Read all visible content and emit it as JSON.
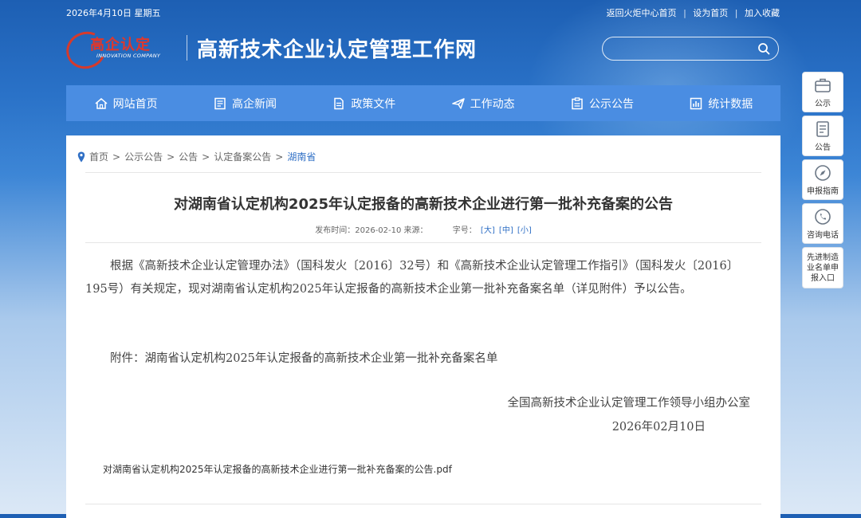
{
  "topbar": {
    "date": "2026年4月10日 星期五",
    "links": [
      "返回火炬中心首页",
      "设为首页",
      "加入收藏"
    ],
    "separator": "|"
  },
  "logo": {
    "brand": "高企认定",
    "brand_en": "INNOVATION COMPANY"
  },
  "site_title": "高新技术企业认定管理工作网",
  "search": {
    "placeholder": "",
    "icon": "search-icon"
  },
  "nav": [
    {
      "label": "网站首页",
      "icon": "home-icon"
    },
    {
      "label": "高企新闻",
      "icon": "news-icon"
    },
    {
      "label": "政策文件",
      "icon": "document-icon"
    },
    {
      "label": "工作动态",
      "icon": "paper-plane-icon"
    },
    {
      "label": "公示公告",
      "icon": "clipboard-icon"
    },
    {
      "label": "统计数据",
      "icon": "chart-icon"
    }
  ],
  "breadcrumb": {
    "items": [
      "首页",
      "公示公告",
      "公告",
      "认定备案公告",
      "湖南省"
    ],
    "separator": ">"
  },
  "article": {
    "title": "对湖南省认定机构2025年认定报备的高新技术企业进行第一批补充备案的公告",
    "meta": "发布时间：2026-02-10 来源：",
    "font_size_label": "字号：",
    "font_sizes": [
      "[大]",
      "[中]",
      "[小]"
    ],
    "paragraph1": "根据《高新技术企业认定管理办法》（国科发火〔2016〕32号）和《高新技术企业认定管理工作指引》（国科发火〔2016〕195号）有关规定，现对湖南省认定机构2025年认定报备的高新技术企业第一批补充备案名单（详见附件）予以公告。",
    "paragraph2": "附件：湖南省认定机构2025年认定报备的高新技术企业第一批补充备案名单",
    "signature_org": "全国高新技术企业认定管理工作领导小组办公室",
    "signature_date": "2026年02月10日",
    "attachment_link": "对湖南省认定机构2025年认定报备的高新技术企业进行第一批补充备案的公告.pdf"
  },
  "sidebar": [
    {
      "label": "公示",
      "icon": "briefcase-icon"
    },
    {
      "label": "公告",
      "icon": "notice-icon"
    },
    {
      "label": "申报指南",
      "icon": "compass-icon"
    },
    {
      "label": "咨询电话",
      "icon": "phone-icon"
    },
    {
      "label": "先进制造业名单申报入口"
    }
  ],
  "colors": {
    "nav_bg": "#4a8de2",
    "accent": "#2f6fc5",
    "brand_red": "#e1372a"
  }
}
